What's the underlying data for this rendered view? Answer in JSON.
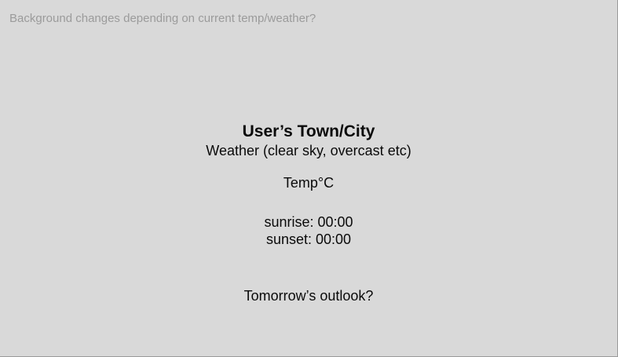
{
  "annotation": "Background changes depending on current temp/weather?",
  "weather_card": {
    "city": "User’s Town/City",
    "condition": "Weather (clear sky, overcast etc)",
    "temperature": "Temp°C",
    "sunrise": "sunrise: 00:00",
    "sunset": "sunset: 00:00",
    "outlook": "Tomorrow’s outlook?"
  },
  "colors": {
    "background": "#d9d9d9",
    "text": "#0a0a0a",
    "annotation_text": "#9b9b9b"
  }
}
